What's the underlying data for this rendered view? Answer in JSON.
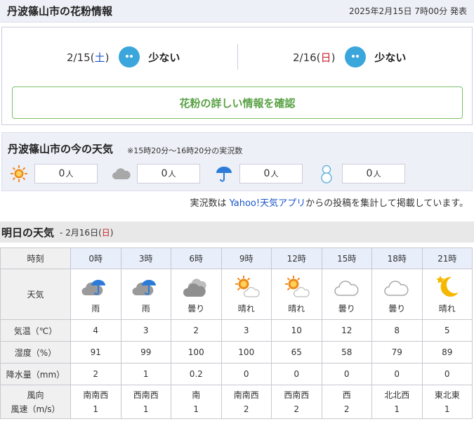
{
  "pollen": {
    "title": "丹波篠山市の花粉情報",
    "issued": "2025年2月15日 7時00分 発表",
    "days": [
      {
        "date_prefix": "2/15(",
        "weekday": "土",
        "date_suffix": ")",
        "level": "少ない",
        "weekday_color": "#1a56c8"
      },
      {
        "date_prefix": "2/16(",
        "weekday": "日",
        "date_suffix": ")",
        "level": "少ない",
        "weekday_color": "#c8202a"
      }
    ],
    "detail_button": "花粉の詳しい情報を確認"
  },
  "current": {
    "title": "丹波篠山市の今の天気",
    "note": "※15時20分～16時20分の実況数",
    "counts": [
      {
        "icon": "sun-icon",
        "value": "0",
        "unit": "人"
      },
      {
        "icon": "cloud-icon",
        "value": "0",
        "unit": "人"
      },
      {
        "icon": "umbrella-icon",
        "value": "0",
        "unit": "人"
      },
      {
        "icon": "snowman-icon",
        "value": "0",
        "unit": "人"
      }
    ],
    "source_prefix": "実況数は ",
    "source_link": "Yahoo!天気アプリ",
    "source_suffix": "からの投稿を集計して掲載しています。"
  },
  "tomorrow": {
    "title": "明日の天気",
    "date_prefix": "- 2月16日(",
    "weekday": "日",
    "date_suffix": ")",
    "row_labels": {
      "time": "時刻",
      "weather": "天気",
      "temp": "気温（℃）",
      "humidity": "湿度（%）",
      "precip": "降水量（mm）",
      "wind_dir": "風向",
      "wind_speed": "風速（m/s）"
    },
    "hours": [
      "0時",
      "3時",
      "6時",
      "9時",
      "12時",
      "15時",
      "18時",
      "21時"
    ],
    "weather": [
      {
        "icon": "cloud-umbrella-icon",
        "label": "雨"
      },
      {
        "icon": "cloud-umbrella-icon",
        "label": "雨"
      },
      {
        "icon": "clouds-icon",
        "label": "曇り"
      },
      {
        "icon": "sun-cloud-icon",
        "label": "晴れ"
      },
      {
        "icon": "sun-cloud-icon",
        "label": "晴れ"
      },
      {
        "icon": "cloud-icon",
        "label": "曇り"
      },
      {
        "icon": "cloud-icon",
        "label": "曇り"
      },
      {
        "icon": "moon-star-icon",
        "label": "晴れ"
      }
    ],
    "temp": [
      "4",
      "3",
      "2",
      "3",
      "10",
      "12",
      "8",
      "5"
    ],
    "humidity": [
      "91",
      "99",
      "100",
      "100",
      "65",
      "58",
      "79",
      "89"
    ],
    "precip": [
      "2",
      "1",
      "0.2",
      "0",
      "0",
      "0",
      "0",
      "0"
    ],
    "wind_dir": [
      "南南西",
      "西南西",
      "南",
      "南南西",
      "西南西",
      "西",
      "北北西",
      "東北東"
    ],
    "wind_speed": [
      "1",
      "1",
      "1",
      "2",
      "2",
      "2",
      "1",
      "1"
    ]
  },
  "colors": {
    "accent": "#3ba6dc",
    "saturday": "#1a56c8",
    "sunday": "#c8202a",
    "button_green": "#5aa246"
  }
}
